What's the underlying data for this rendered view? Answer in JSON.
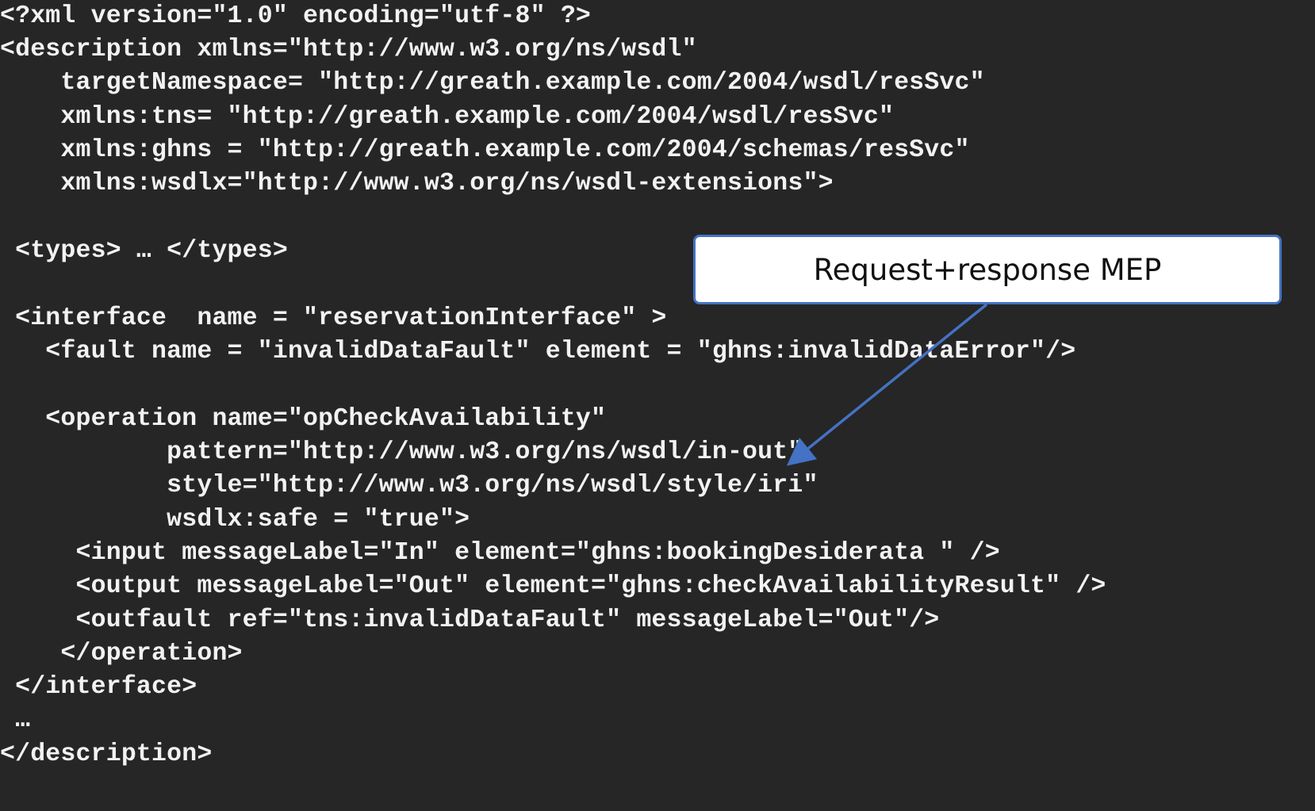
{
  "code_lines": [
    "<?xml version=\"1.0\" encoding=\"utf-8\" ?>",
    "<description xmlns=\"http://www.w3.org/ns/wsdl\"",
    "    targetNamespace= \"http://greath.example.com/2004/wsdl/resSvc\"",
    "    xmlns:tns= \"http://greath.example.com/2004/wsdl/resSvc\"",
    "    xmlns:ghns = \"http://greath.example.com/2004/schemas/resSvc\"",
    "    xmlns:wsdlx=\"http://www.w3.org/ns/wsdl-extensions\">",
    " <types> … </types>",
    " <interface  name = \"reservationInterface\" >",
    "   <fault name = \"invalidDataFault\" element = \"ghns:invalidDataError\"/>",
    "   <operation name=\"opCheckAvailability\"",
    "           pattern=\"http://www.w3.org/ns/wsdl/in-out\"",
    "           style=\"http://www.w3.org/ns/wsdl/style/iri\"",
    "           wsdlx:safe = \"true\">",
    "     <input messageLabel=\"In\" element=\"ghns:bookingDesiderata \" />",
    "     <output messageLabel=\"Out\" element=\"ghns:checkAvailabilityResult\" />",
    "     <outfault ref=\"tns:invalidDataFault\" messageLabel=\"Out\"/>",
    "    </operation>",
    " </interface>",
    " …",
    "</description>"
  ],
  "callout": {
    "text": "Request+response MEP"
  },
  "colors": {
    "background": "#262626",
    "code_text": "#f2f2f2",
    "callout_border": "#4472c4",
    "arrow": "#4472c4"
  }
}
